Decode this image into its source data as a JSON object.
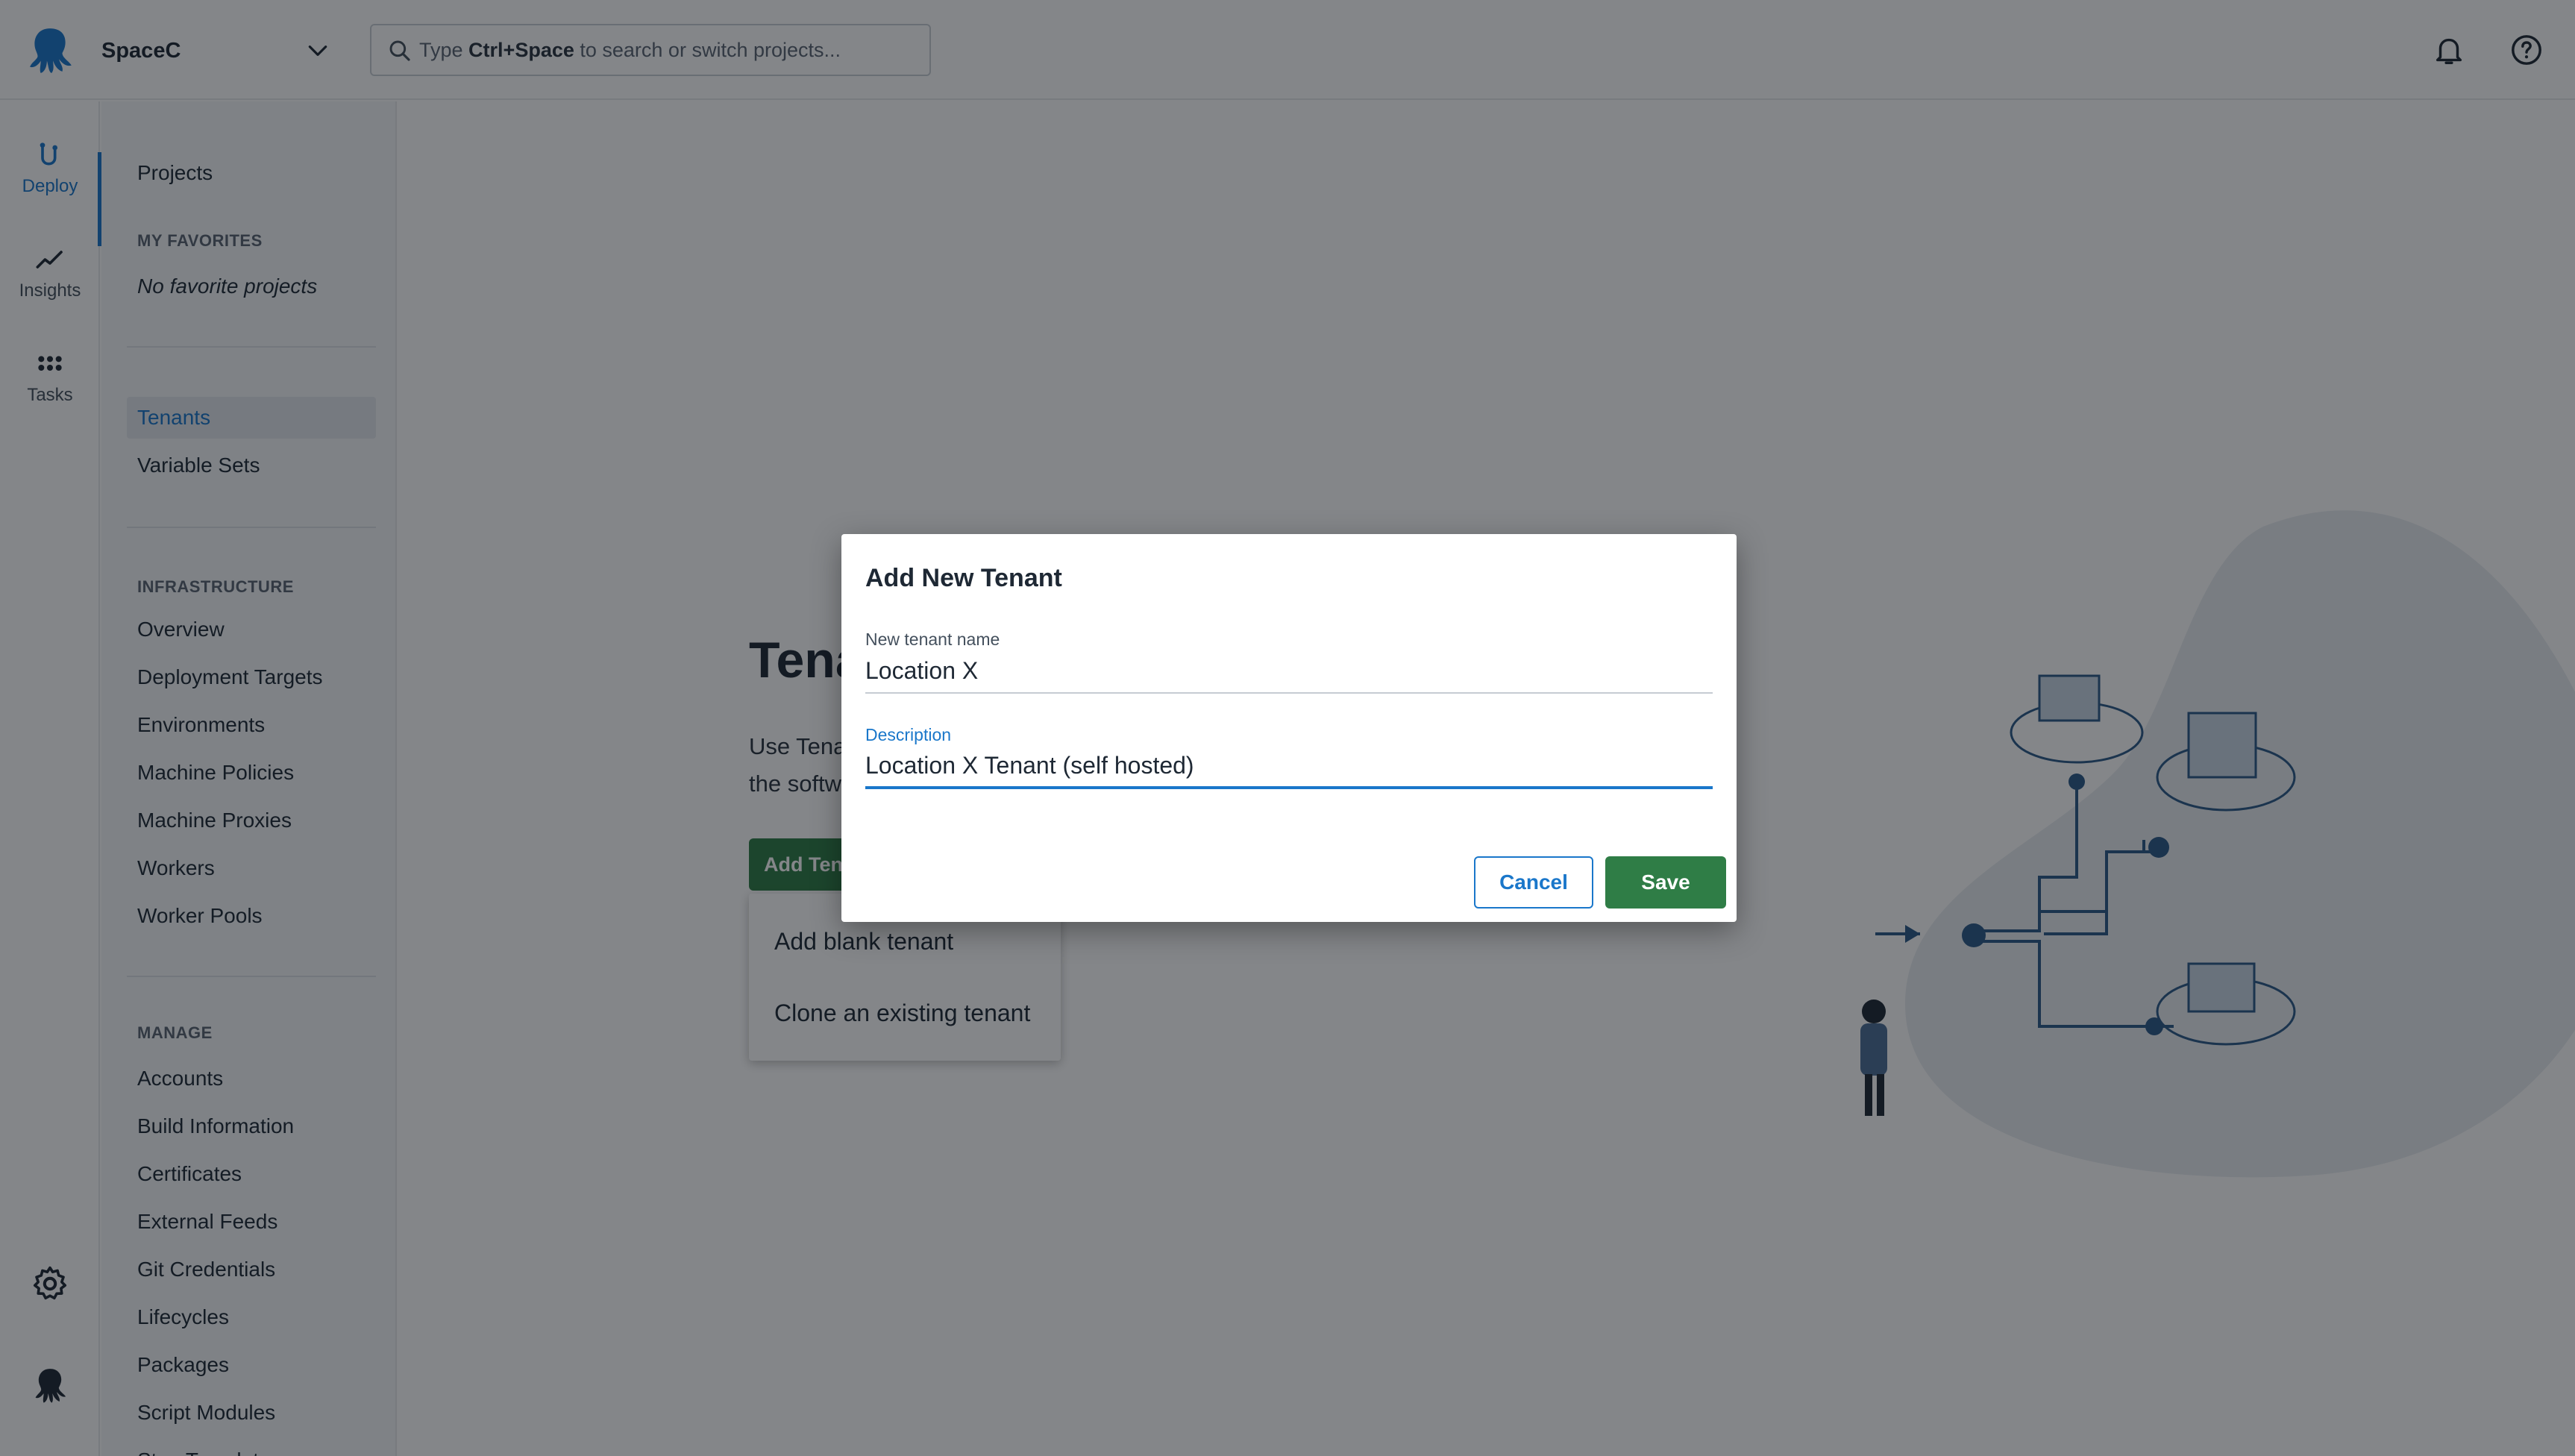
{
  "header": {
    "space_name": "SpaceC",
    "search_placeholder_pre": "Type ",
    "search_placeholder_key": "Ctrl+Space",
    "search_placeholder_post": " to search or switch projects..."
  },
  "rail": {
    "items": [
      {
        "label": "Deploy",
        "icon": "deploy-icon"
      },
      {
        "label": "Insights",
        "icon": "insights-icon"
      },
      {
        "label": "Tasks",
        "icon": "tasks-icon"
      }
    ]
  },
  "sidebar": {
    "projects": "Projects",
    "favorites_heading": "MY FAVORITES",
    "favorites_empty": "No favorite projects",
    "tenants": "Tenants",
    "variable_sets": "Variable Sets",
    "infrastructure_heading": "INFRASTRUCTURE",
    "infrastructure": [
      "Overview",
      "Deployment Targets",
      "Environments",
      "Machine Policies",
      "Machine Proxies",
      "Workers",
      "Worker Pools"
    ],
    "manage_heading": "MANAGE",
    "manage": [
      "Accounts",
      "Build Information",
      "Certificates",
      "External Feeds",
      "Git Credentials",
      "Lifecycles",
      "Packages",
      "Script Modules",
      "Step Templates"
    ]
  },
  "main": {
    "title": "Tenants",
    "intro_line1": "Use Tenants",
    "intro_line2": "the software",
    "add_button": "Add Tenant",
    "menu": [
      "Add blank tenant",
      "Clone an existing tenant"
    ]
  },
  "dialog": {
    "title": "Add New Tenant",
    "name_label": "New tenant name",
    "name_value": "Location X",
    "description_label": "Description",
    "description_value": "Location X Tenant (self hosted)",
    "cancel": "Cancel",
    "save": "Save"
  },
  "colors": {
    "accent": "#1a77ca",
    "primary_button": "#2f7d46",
    "overlay": "rgba(10,14,20,0.5)"
  }
}
